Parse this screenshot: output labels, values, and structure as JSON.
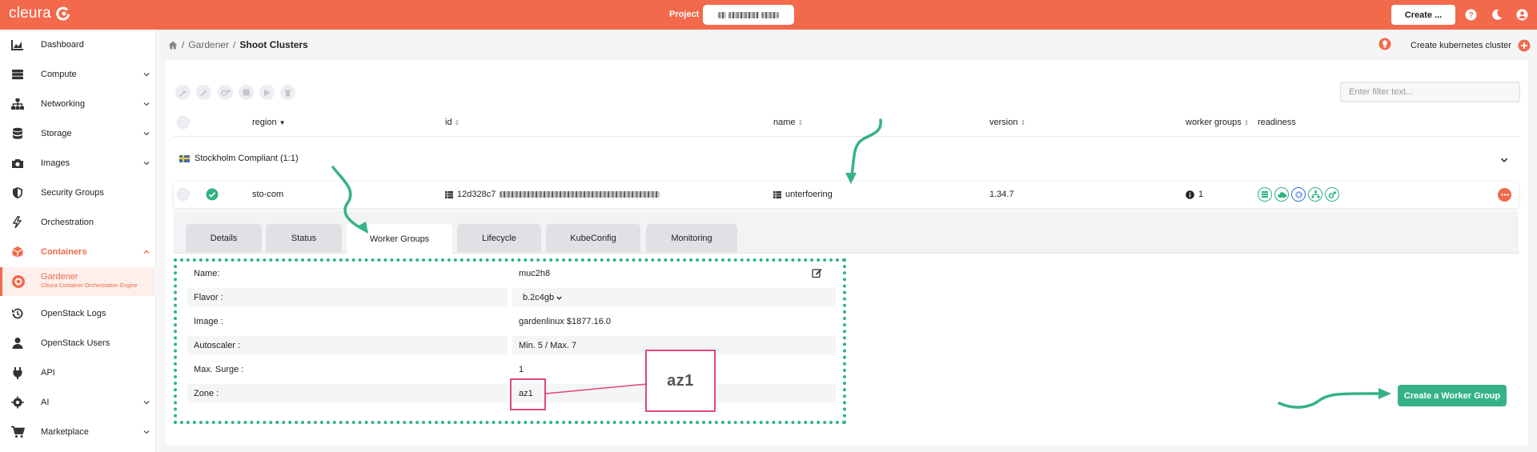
{
  "app": {
    "logo_text": "cleura",
    "accent": "#f2694b"
  },
  "topbar": {
    "project_label": "Project",
    "create_label": "Create ...",
    "icons": [
      "help-icon",
      "moon-icon",
      "user-icon"
    ]
  },
  "sidebar": {
    "items": [
      {
        "label": "Dashboard",
        "icon": "chart-icon"
      },
      {
        "label": "Compute",
        "icon": "server-icon"
      },
      {
        "label": "Networking",
        "icon": "network-icon"
      },
      {
        "label": "Storage",
        "icon": "database-icon"
      },
      {
        "label": "Images",
        "icon": "camera-icon"
      },
      {
        "label": "Security Groups",
        "icon": "shield-icon"
      },
      {
        "label": "Orchestration",
        "icon": "orchestration-icon"
      },
      {
        "label": "Containers",
        "icon": "box-icon"
      },
      {
        "label": "Gardener",
        "sublabel": "Cleura Container Orchestration Engine",
        "icon": "gardener-icon"
      },
      {
        "label": "OpenStack Logs",
        "icon": "history-icon"
      },
      {
        "label": "OpenStack Users",
        "icon": "user-icon"
      },
      {
        "label": "API",
        "icon": "plug-icon"
      },
      {
        "label": "AI",
        "icon": "ai-icon"
      },
      {
        "label": "Marketplace",
        "icon": "cart-icon"
      }
    ]
  },
  "breadcrumb": {
    "home": "home-icon",
    "sep": "/",
    "parent": "Gardener",
    "current": "Shoot Clusters"
  },
  "header_action": {
    "label": "Create kubernetes cluster"
  },
  "filter": {
    "placeholder": "Enter filter text..."
  },
  "table": {
    "columns": {
      "region": "region",
      "id": "id",
      "name": "name",
      "version": "version",
      "worker_groups": "worker groups",
      "readiness": "readiness"
    },
    "group": {
      "label": "Stockholm Compliant (1:1)"
    },
    "row": {
      "region": "sto-com",
      "id_prefix": "12d328c7",
      "name": "unterfoering",
      "version": "1.34.7",
      "worker_groups": "1"
    }
  },
  "tabs": [
    "Details",
    "Status",
    "Worker Groups",
    "Lifecycle",
    "KubeConfig",
    "Monitoring"
  ],
  "worker_group": {
    "fields": [
      {
        "label": "Name:",
        "value": "muc2h8"
      },
      {
        "label": "Flavor :",
        "value": "b.2c4gb"
      },
      {
        "label": "Image :",
        "value": "gardenlinux $1877.16.0"
      },
      {
        "label": "Autoscaler :",
        "value": "Min. 5 / Max. 7"
      },
      {
        "label": "Max. Surge :",
        "value": "1"
      },
      {
        "label": "Zone :",
        "value": "az1"
      }
    ],
    "zoom_text": "az1",
    "create_button": "Create a Worker Group"
  }
}
